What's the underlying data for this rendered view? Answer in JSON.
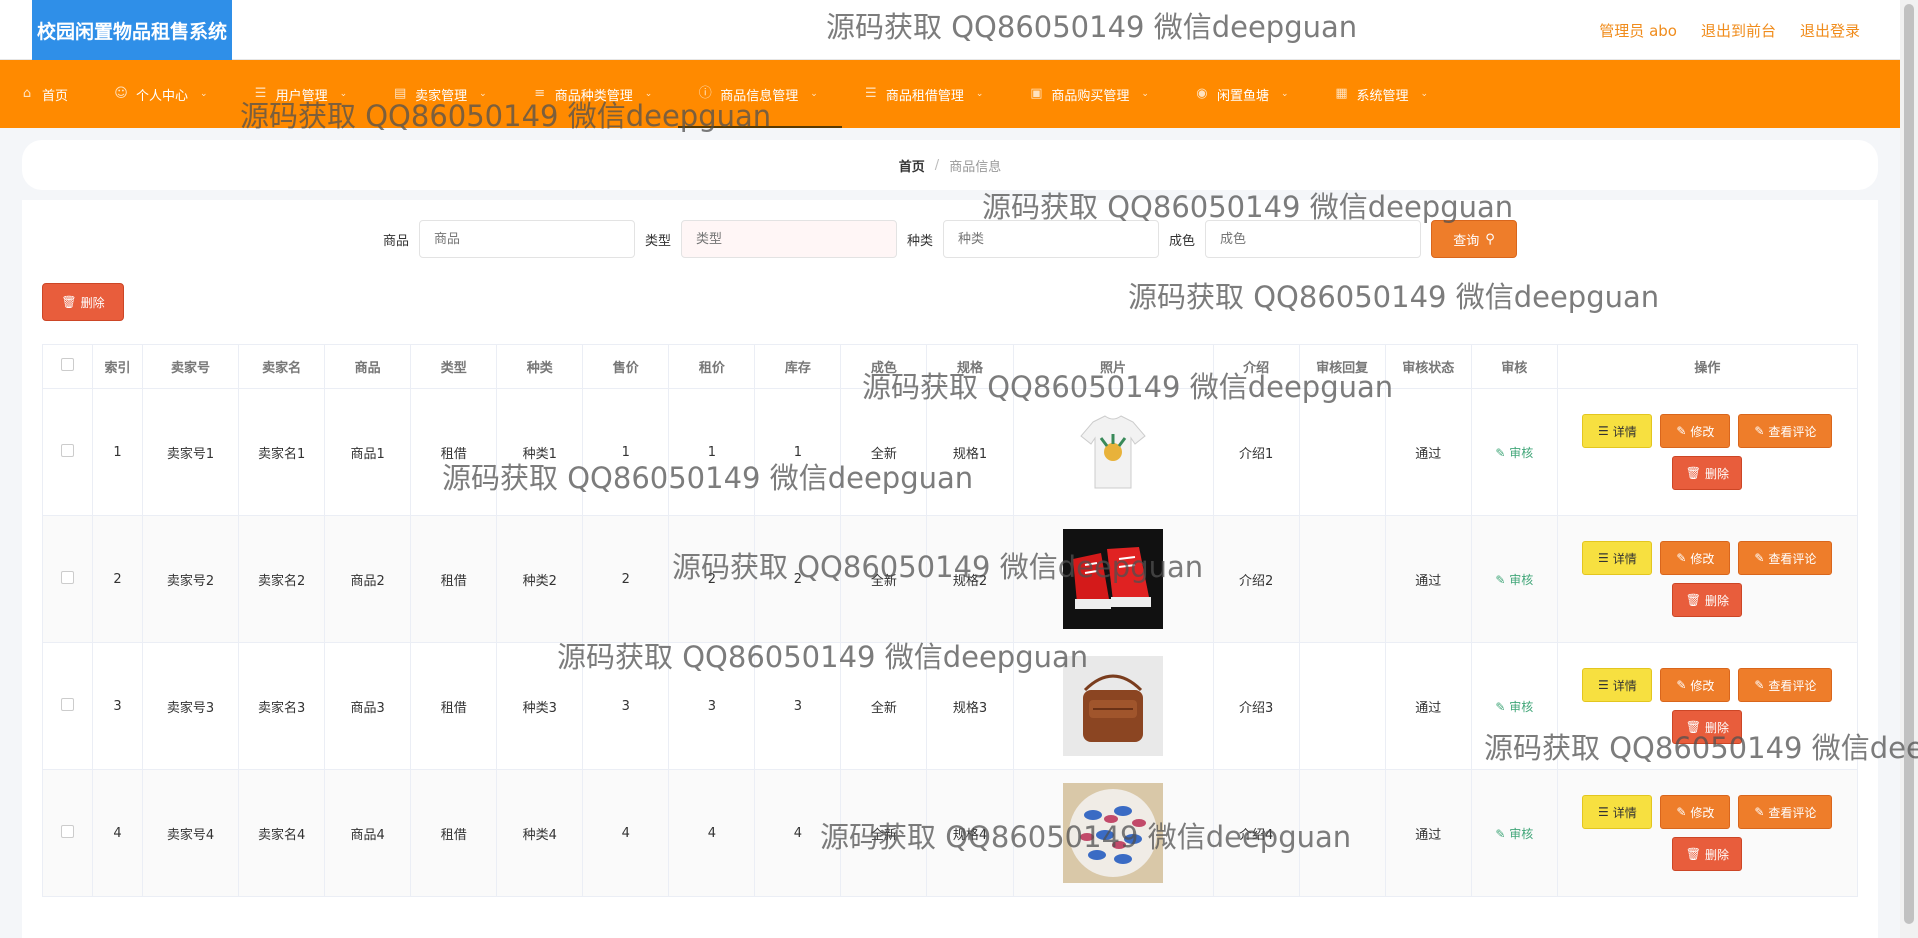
{
  "app": {
    "title": "校园闲置物品租售系统"
  },
  "top_links": {
    "admin": "管理员 abo",
    "to_front": "退出到前台",
    "logout": "退出登录"
  },
  "nav": [
    {
      "label": "首页",
      "icon": "home-icon",
      "caret": false
    },
    {
      "label": "个人中心",
      "icon": "user-icon",
      "caret": true
    },
    {
      "label": "用户管理",
      "icon": "list-icon",
      "caret": true
    },
    {
      "label": "卖家管理",
      "icon": "shop-icon",
      "caret": true
    },
    {
      "label": "商品种类管理",
      "icon": "chart-icon",
      "caret": true
    },
    {
      "label": "商品信息管理",
      "icon": "info-icon",
      "caret": true,
      "active": true
    },
    {
      "label": "商品租借管理",
      "icon": "rent-icon",
      "caret": true
    },
    {
      "label": "商品购买管理",
      "icon": "cart-icon",
      "caret": true
    },
    {
      "label": "闲置鱼塘",
      "icon": "pin-icon",
      "caret": true
    },
    {
      "label": "系统管理",
      "icon": "settings-icon",
      "caret": true
    }
  ],
  "breadcrumb": {
    "home": "首页",
    "separator": "/",
    "current": "商品信息"
  },
  "search": {
    "fields": [
      {
        "label": "商品",
        "placeholder": "商品"
      },
      {
        "label": "类型",
        "placeholder": "类型"
      },
      {
        "label": "种类",
        "placeholder": "种类"
      },
      {
        "label": "成色",
        "placeholder": "成色"
      }
    ],
    "query_label": "查询"
  },
  "batch_delete_label": "删除",
  "table": {
    "headers": [
      "",
      "索引",
      "卖家号",
      "卖家名",
      "商品",
      "类型",
      "种类",
      "售价",
      "租价",
      "库存",
      "成色",
      "规格",
      "照片",
      "介绍",
      "审核回复",
      "审核状态",
      "审核",
      "操作"
    ],
    "rows": [
      {
        "index": "1",
        "seller_no": "卖家号1",
        "seller_name": "卖家名1",
        "goods": "商品1",
        "type": "租借",
        "category": "种类1",
        "price": "1",
        "rent": "1",
        "stock": "1",
        "condition": "全新",
        "spec": "规格1",
        "photo": "tshirt",
        "intro": "介绍1",
        "reply": "",
        "status": "通过",
        "audit": "审核"
      },
      {
        "index": "2",
        "seller_no": "卖家号2",
        "seller_name": "卖家名2",
        "goods": "商品2",
        "type": "租借",
        "category": "种类2",
        "price": "2",
        "rent": "2",
        "stock": "2",
        "condition": "全新",
        "spec": "规格2",
        "photo": "sneakers",
        "intro": "介绍2",
        "reply": "",
        "status": "通过",
        "audit": "审核"
      },
      {
        "index": "3",
        "seller_no": "卖家号3",
        "seller_name": "卖家名3",
        "goods": "商品3",
        "type": "租借",
        "category": "种类3",
        "price": "3",
        "rent": "3",
        "stock": "3",
        "condition": "全新",
        "spec": "规格3",
        "photo": "bag",
        "intro": "介绍3",
        "reply": "",
        "status": "通过",
        "audit": "审核"
      },
      {
        "index": "4",
        "seller_no": "卖家号4",
        "seller_name": "卖家名4",
        "goods": "商品4",
        "type": "租借",
        "category": "种类4",
        "price": "4",
        "rent": "4",
        "stock": "4",
        "condition": "全新",
        "spec": "规格4",
        "photo": "candy",
        "intro": "介绍4",
        "reply": "",
        "status": "通过",
        "audit": "审核"
      }
    ],
    "actions": {
      "detail": "详情",
      "edit": "修改",
      "comment": "查看评论",
      "delete": "删除"
    }
  },
  "watermark": "源码获取 QQ86050149 微信deepguan"
}
